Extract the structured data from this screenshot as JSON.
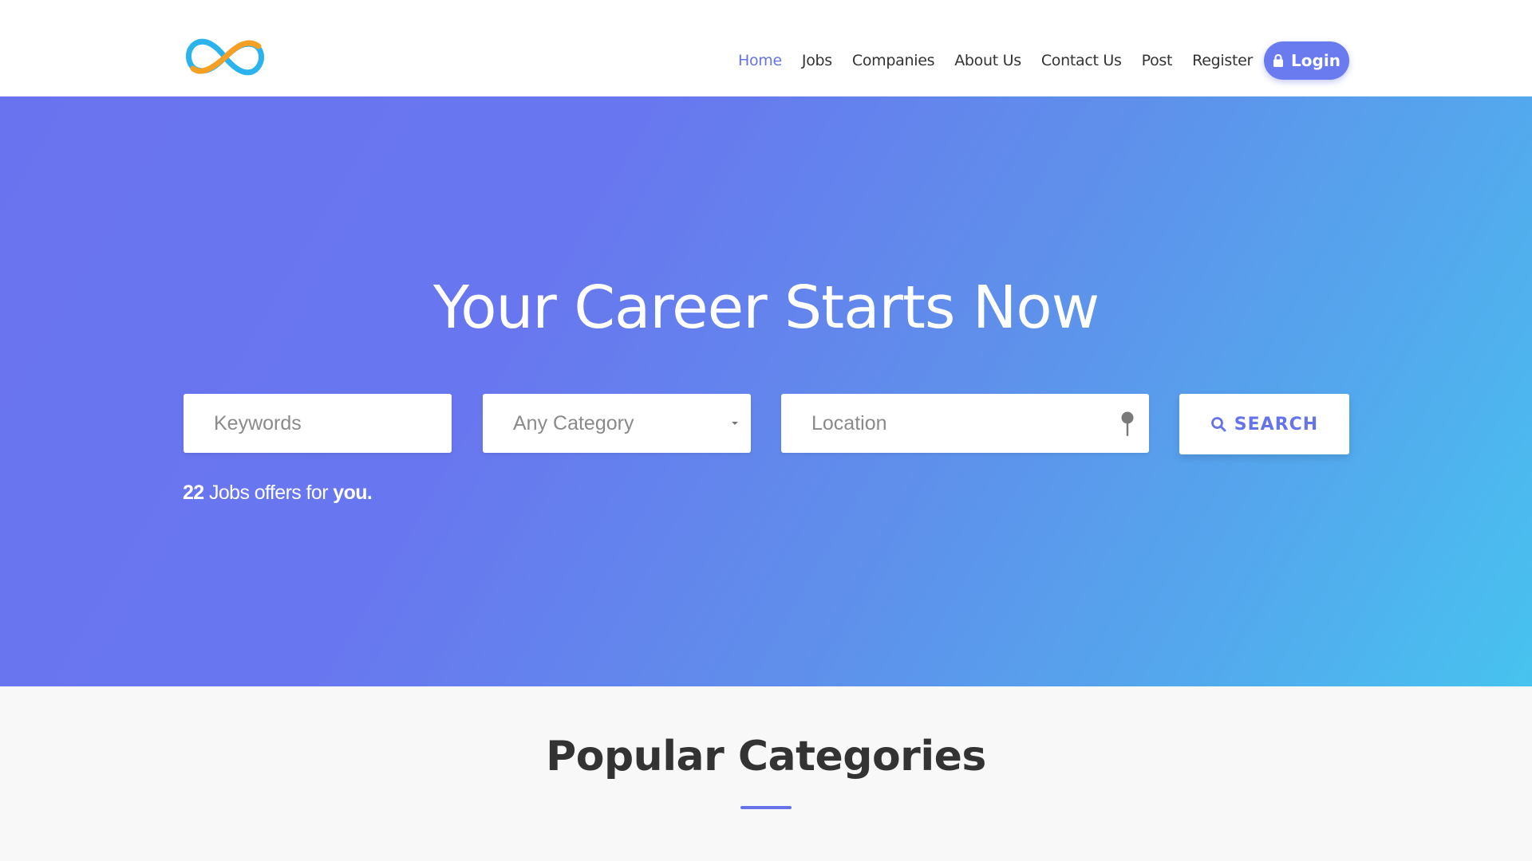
{
  "header": {
    "logo_icon": "infinity-logo",
    "nav": [
      {
        "label": "Home",
        "active": true
      },
      {
        "label": "Jobs",
        "active": false
      },
      {
        "label": "Companies",
        "active": false
      },
      {
        "label": "About Us",
        "active": false
      },
      {
        "label": "Contact Us",
        "active": false
      },
      {
        "label": "Post",
        "active": false
      },
      {
        "label": "Register",
        "active": false
      }
    ],
    "login_label": "Login",
    "login_icon": "lock-icon"
  },
  "hero": {
    "title": "Your Career Starts Now",
    "keywords_placeholder": "Keywords",
    "category_value": "Any Category",
    "location_placeholder": "Location",
    "location_icon": "map-pin-icon",
    "search_label": "SEARCH",
    "search_icon": "search-icon",
    "jobs_count": "22",
    "jobs_text_middle": "Jobs offers for",
    "jobs_text_end": "you."
  },
  "categories": {
    "title": "Popular Categories"
  },
  "colors": {
    "accent": "#6674ec",
    "gradient_start": "#6a73ef",
    "gradient_end": "#47c3ef"
  }
}
